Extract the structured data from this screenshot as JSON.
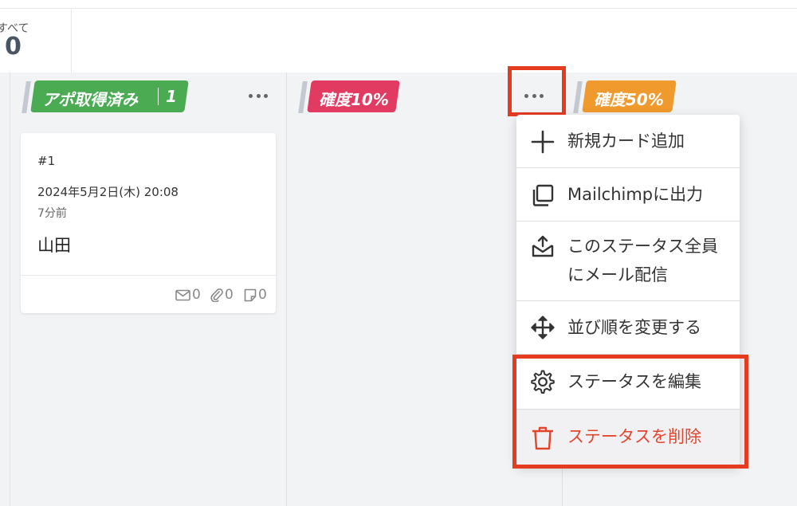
{
  "summary": {
    "label": "すべて",
    "count": "0"
  },
  "columns": [
    {
      "name": "アポ取得済み",
      "count": "1",
      "color": "#4bab52"
    },
    {
      "name": "確度10%",
      "color": "#e13b61"
    },
    {
      "name": "確度50%",
      "color": "#f09a2d"
    }
  ],
  "card": {
    "number": "#1",
    "date": "2024年5月2日(木) 20:08",
    "relative_time": "7分前",
    "name": "山田",
    "mail_count": "0",
    "attachment_count": "0",
    "memo_count": "0"
  },
  "menu": {
    "items": [
      {
        "label": "新規カード追加",
        "icon": "plus-icon"
      },
      {
        "label": "Mailchimpに出力",
        "icon": "copy-icon"
      },
      {
        "label_line1": "このステータス全員",
        "label_line2": "にメール配信",
        "icon": "mail-send-icon"
      },
      {
        "label": "並び順を変更する",
        "icon": "move-icon"
      },
      {
        "label": "ステータスを編集",
        "icon": "gear-icon"
      },
      {
        "label": "ステータスを削除",
        "icon": "trash-icon"
      }
    ]
  },
  "colors": {
    "highlight": "#e53b21",
    "danger": "#e2452c"
  }
}
